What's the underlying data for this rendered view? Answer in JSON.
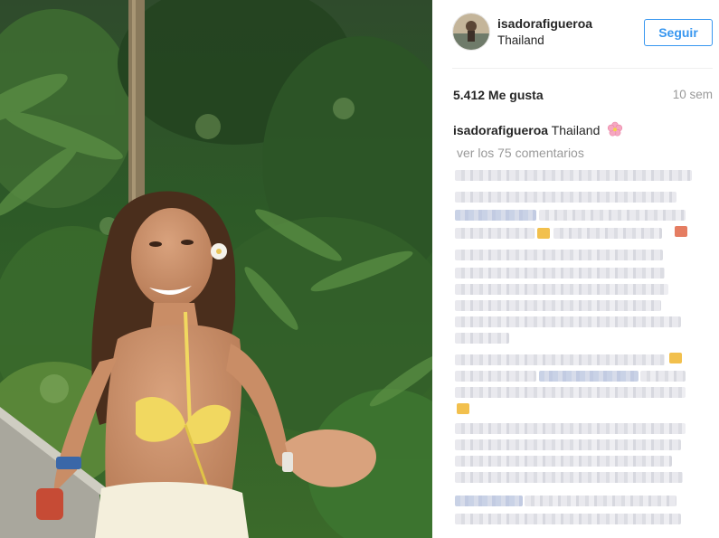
{
  "post": {
    "image_alt": "Photo",
    "user": {
      "username": "isadorafigueroa",
      "location": "Thailand"
    },
    "follow_label": "Seguir",
    "likes": "5.412 Me gusta",
    "time_ago": "10 sem",
    "caption": {
      "username": "isadorafigueroa",
      "text": "Thailand"
    },
    "view_comments": "ver los 75 comentarios"
  },
  "colors": {
    "accent": "#3897f0",
    "text": "#262626",
    "muted": "#999999"
  }
}
